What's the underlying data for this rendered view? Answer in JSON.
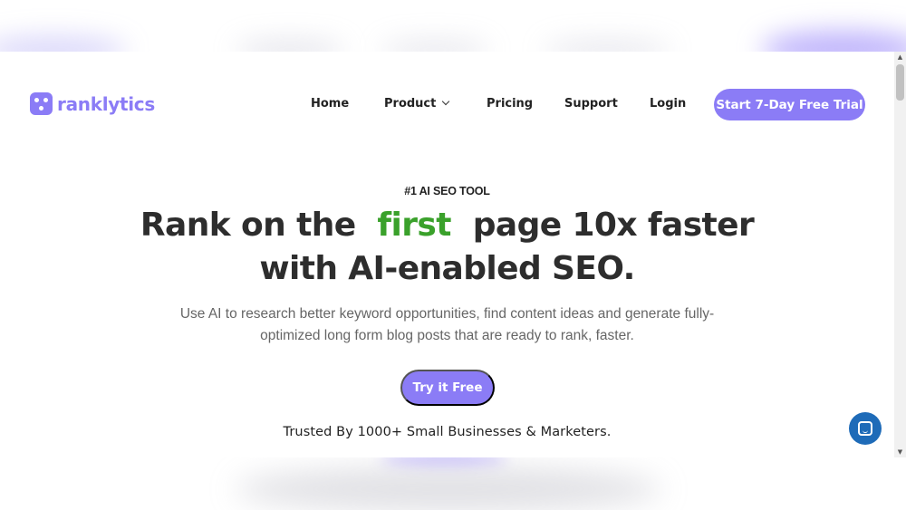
{
  "brand": {
    "name": "ranklytics",
    "color": "#8b7cf6"
  },
  "nav": {
    "items": [
      {
        "label": "Home"
      },
      {
        "label": "Product"
      },
      {
        "label": "Pricing"
      },
      {
        "label": "Support"
      },
      {
        "label": "Login"
      }
    ],
    "cta_label": "Start 7-Day Free Trial"
  },
  "hero": {
    "eyebrow": "#1 AI SEO TOOL",
    "headline_pre": "Rank on the",
    "headline_highlight": "first",
    "headline_post": "page 10x faster",
    "headline_line2": "with AI-enabled SEO.",
    "highlight_color": "#3aa12b",
    "sub_line1": "Use AI to research better keyword opportunities, find content ideas and generate fully-",
    "sub_line2": "optimized long form blog posts that are ready to rank, faster.",
    "cta_label": "Try it Free",
    "trusted": "Trusted By 1000+ Small Businesses & Marketers."
  },
  "icons": {
    "logo": "logo-dice-icon",
    "product_dropdown": "chevron-down-icon",
    "chat": "chat-icon"
  },
  "colors": {
    "chat_button": "#1e6bb8"
  }
}
